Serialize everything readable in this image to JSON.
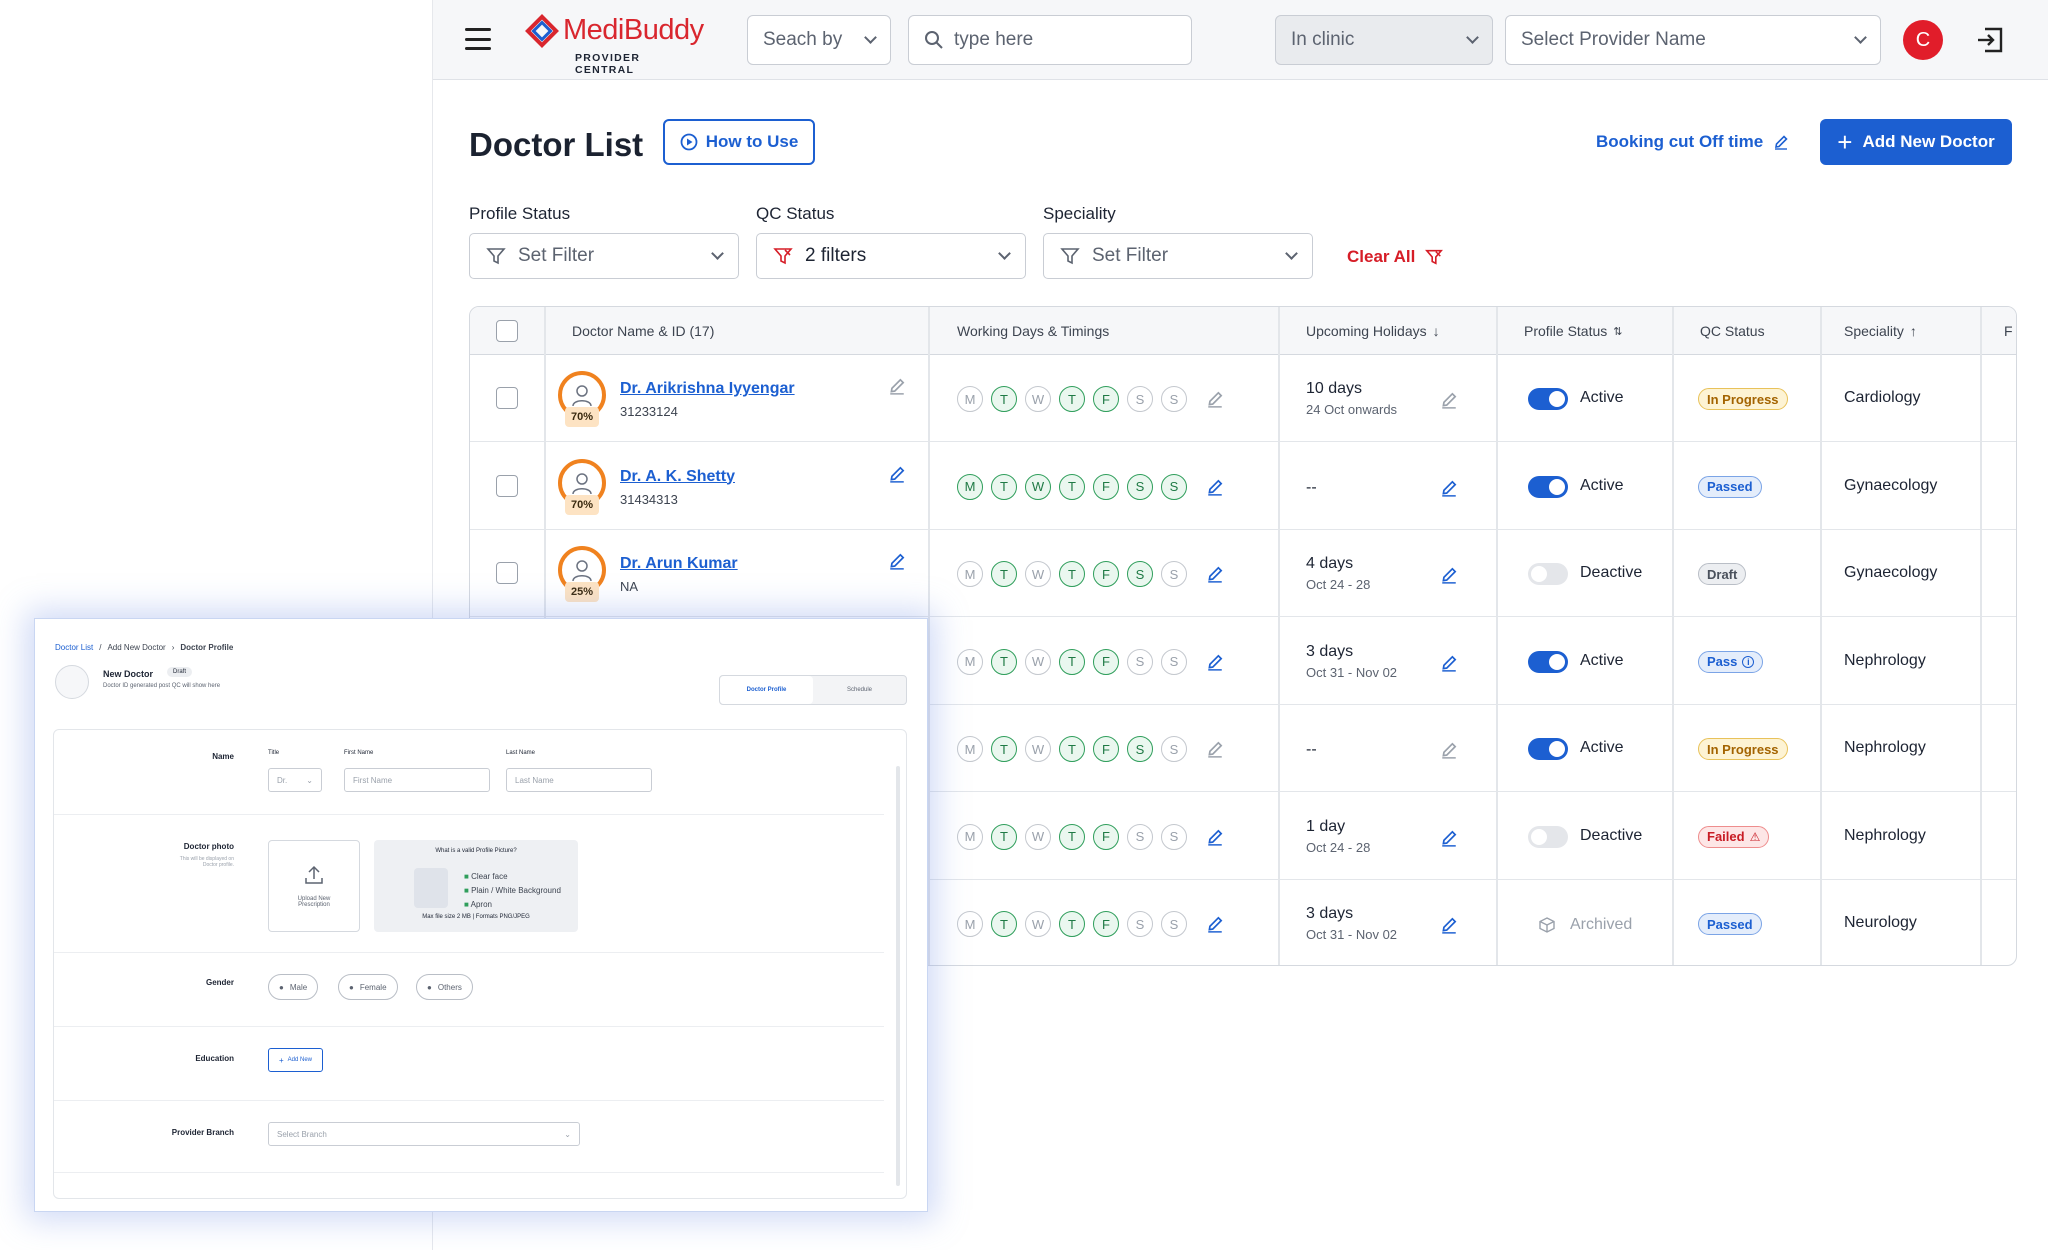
{
  "topbar": {
    "brand": "MediBuddy",
    "brand_sub": "PROVIDER CENTRAL",
    "search_by": "Seach by",
    "search_placeholder": "type here",
    "clinic_mode": "In clinic",
    "provider_placeholder": "Select Provider Name",
    "avatar_initial": "C"
  },
  "header": {
    "title": "Doctor List",
    "how_to_use": "How to Use",
    "booking_cutoff": "Booking cut Off time",
    "add_doctor": "Add New Doctor"
  },
  "filters": {
    "profile_status_label": "Profile Status",
    "profile_status_value": "Set Filter",
    "qc_status_label": "QC Status",
    "qc_status_value": "2 filters",
    "speciality_label": "Speciality",
    "speciality_value": "Set Filter",
    "clear_all": "Clear All"
  },
  "table": {
    "columns": [
      "Doctor Name & ID (17)",
      "Working Days & Timings",
      "Upcoming Holidays",
      "Profile Status",
      "QC Status",
      "Speciality",
      "F"
    ],
    "day_letters": [
      "M",
      "T",
      "W",
      "T",
      "F",
      "S",
      "S"
    ],
    "rows": [
      {
        "name": "Dr. Arikrishna Iyyengar",
        "id": "31233124",
        "pct": "70%",
        "days_on": [
          false,
          true,
          false,
          true,
          true,
          false,
          false
        ],
        "holiday": "10 days",
        "holiday_range": "24 Oct onwards",
        "status": "Active",
        "active": true,
        "qc": "In Progress",
        "qc_type": "prog",
        "speciality": "Cardiology"
      },
      {
        "name": "Dr. A. K. Shetty",
        "id": "31434313",
        "pct": "70%",
        "days_on": [
          true,
          true,
          true,
          true,
          true,
          true,
          true
        ],
        "holiday": "--",
        "holiday_range": "",
        "status": "Active",
        "active": true,
        "qc": "Passed",
        "qc_type": "pass",
        "speciality": "Gynaecology"
      },
      {
        "name": "Dr. Arun Kumar",
        "id": "NA",
        "pct": "25%",
        "days_on": [
          false,
          true,
          false,
          true,
          true,
          true,
          false
        ],
        "holiday": "4 days",
        "holiday_range": "Oct 24 - 28",
        "status": "Deactive",
        "active": false,
        "qc": "Draft",
        "qc_type": "draft",
        "speciality": "Gynaecology"
      },
      {
        "name": "",
        "id": "",
        "pct": "",
        "days_on": [
          false,
          true,
          false,
          true,
          true,
          false,
          false
        ],
        "holiday": "3 days",
        "holiday_range": "Oct 31 - Nov 02",
        "status": "Active",
        "active": true,
        "qc": "Pass",
        "qc_type": "pass",
        "speciality": "Nephrology"
      },
      {
        "name": "",
        "id": "",
        "pct": "",
        "days_on": [
          false,
          true,
          false,
          true,
          true,
          true,
          false
        ],
        "holiday": "--",
        "holiday_range": "",
        "status": "Active",
        "active": true,
        "qc": "In Progress",
        "qc_type": "prog",
        "speciality": "Nephrology"
      },
      {
        "name": "",
        "id": "",
        "pct": "",
        "days_on": [
          false,
          true,
          false,
          true,
          true,
          false,
          false
        ],
        "holiday": "1 day",
        "holiday_range": "Oct 24 - 28",
        "status": "Deactive",
        "active": false,
        "qc": "Failed",
        "qc_type": "fail",
        "speciality": "Nephrology"
      },
      {
        "name": "",
        "id": "",
        "pct": "",
        "days_on": [
          false,
          true,
          false,
          true,
          true,
          false,
          false
        ],
        "holiday": "3 days",
        "holiday_range": "Oct 31 - Nov 02",
        "status": "Archived",
        "active": null,
        "qc": "Passed",
        "qc_type": "pass",
        "speciality": "Neurology"
      }
    ]
  },
  "inset": {
    "breadcrumb": [
      "Doctor List",
      "Add New Doctor",
      "Doctor Profile"
    ],
    "new_doctor": "New Doctor",
    "draft": "Draft",
    "id_hint": "Doctor ID generated post QC will show here",
    "tab_profile": "Doctor Profile",
    "tab_schedule": "Schedule",
    "name_label": "Name",
    "title_label": "Title",
    "title_value": "Dr.",
    "first_name_label": "First Name",
    "first_name_placeholder": "First Name",
    "last_name_label": "Last Name",
    "last_name_placeholder": "Last Name",
    "photo_label": "Doctor photo",
    "photo_hint": "This will be displayed on Doctor profile.",
    "upload_label": "Upload New Prescription",
    "valid_title": "What is a valid Profile Picture?",
    "valid_items": [
      "Clear face",
      "Plain / White Background",
      "Apron"
    ],
    "valid_note": "Max file size 2 MB | Formats PNG/JPEG",
    "gender_label": "Gender",
    "genders": [
      "Male",
      "Female",
      "Others"
    ],
    "education_label": "Education",
    "add_new": "Add New",
    "branch_label": "Provider Branch",
    "branch_placeholder": "Select Branch"
  },
  "colors": {
    "accent": "#1c5fd1",
    "danger": "#d61d27",
    "success": "#2f9e5b",
    "warning": "#f0821f"
  }
}
